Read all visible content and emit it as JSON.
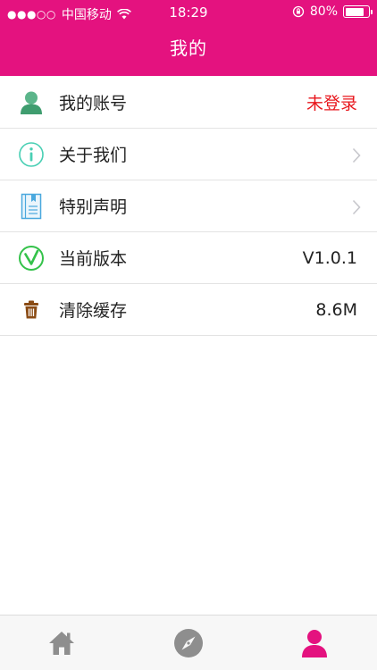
{
  "status_bar": {
    "signal": "●●●○○",
    "carrier": "中国移动",
    "time": "18:29",
    "battery": "80%",
    "battery_level": 0.8
  },
  "nav": {
    "title": "我的"
  },
  "list": [
    {
      "icon": "user-icon",
      "label": "我的账号",
      "value": "未登录",
      "value_color": "#e8161c"
    },
    {
      "icon": "info-icon",
      "label": "关于我们"
    },
    {
      "icon": "notebook-icon",
      "label": "特别声明"
    },
    {
      "icon": "version-check-icon",
      "label": "当前版本",
      "value": "V1.0.1"
    },
    {
      "icon": "trash-icon",
      "label": "清除缓存",
      "value": "8.6M"
    }
  ],
  "tabbar": {
    "tabs": [
      {
        "icon": "home-icon",
        "active": false
      },
      {
        "icon": "compass-icon",
        "active": false
      },
      {
        "icon": "profile-icon",
        "active": true
      }
    ],
    "active_color": "#e4127f",
    "inactive_color": "#8e8e8e"
  },
  "colors": {
    "brand": "#e4127f"
  }
}
